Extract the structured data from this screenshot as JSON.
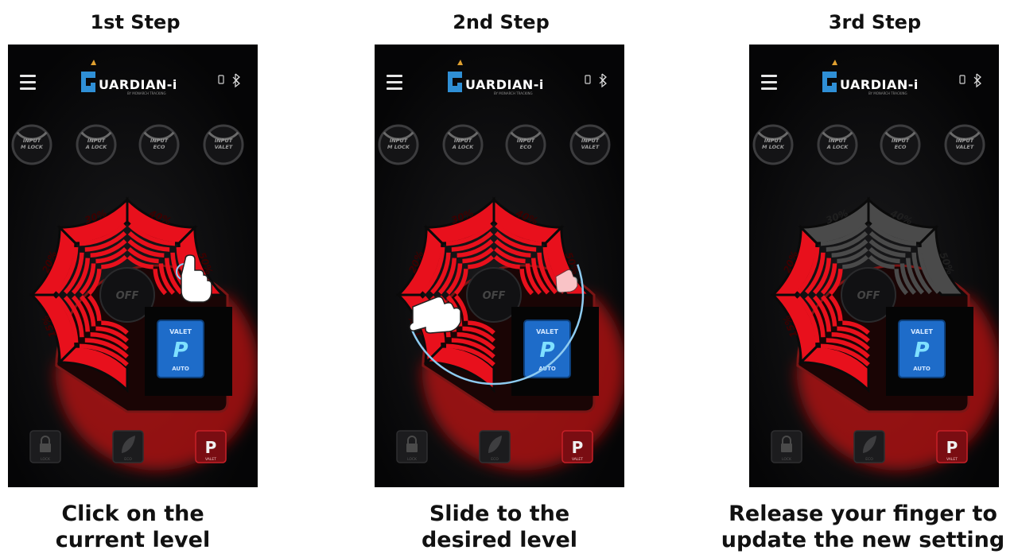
{
  "steps": [
    {
      "title": "1st Step",
      "caption_line1": "Click on the",
      "caption_line2": "current level",
      "active_segments": [
        "15%",
        "20%",
        "30%",
        "40%",
        "50%"
      ],
      "gesture": "tap"
    },
    {
      "title": "2nd Step",
      "caption_line1": "Slide to the",
      "caption_line2": "desired level",
      "active_segments": [
        "15%",
        "20%",
        "30%",
        "40%",
        "50%"
      ],
      "gesture": "slide"
    },
    {
      "title": "3rd Step",
      "caption_line1": "Release your finger to",
      "caption_line2": "update the new setting",
      "active_segments": [
        "15%",
        "20%"
      ],
      "gesture": "none"
    }
  ],
  "app": {
    "brand_main": "UARDIAN-i",
    "brand_sub": "BY MONARCH TRACKING",
    "inputs": [
      {
        "top": "INPUT",
        "bottom": "M LOCK"
      },
      {
        "top": "INPUT",
        "bottom": "A LOCK"
      },
      {
        "top": "INPUT",
        "bottom": "ECO"
      },
      {
        "top": "INPUT",
        "bottom": "VALET"
      }
    ],
    "off_label": "OFF",
    "mode_box": {
      "top": "VALET",
      "letter": "P",
      "bottom": "AUTO"
    },
    "bottom_buttons": [
      {
        "icon": "lock-icon",
        "label": "LOCK"
      },
      {
        "icon": "leaf-icon",
        "label": "ECO"
      },
      {
        "icon": "p-icon",
        "letter": "P",
        "label": "VALET"
      }
    ],
    "segments": [
      "15%",
      "20%",
      "30%",
      "40%",
      "50%"
    ]
  },
  "colors": {
    "active": "#e8101c",
    "inactive": "#4a4a4a",
    "accent_blue": "#2f8fd6",
    "mode_blue": "#1e6cc9",
    "glow": "#ff1a1a"
  }
}
